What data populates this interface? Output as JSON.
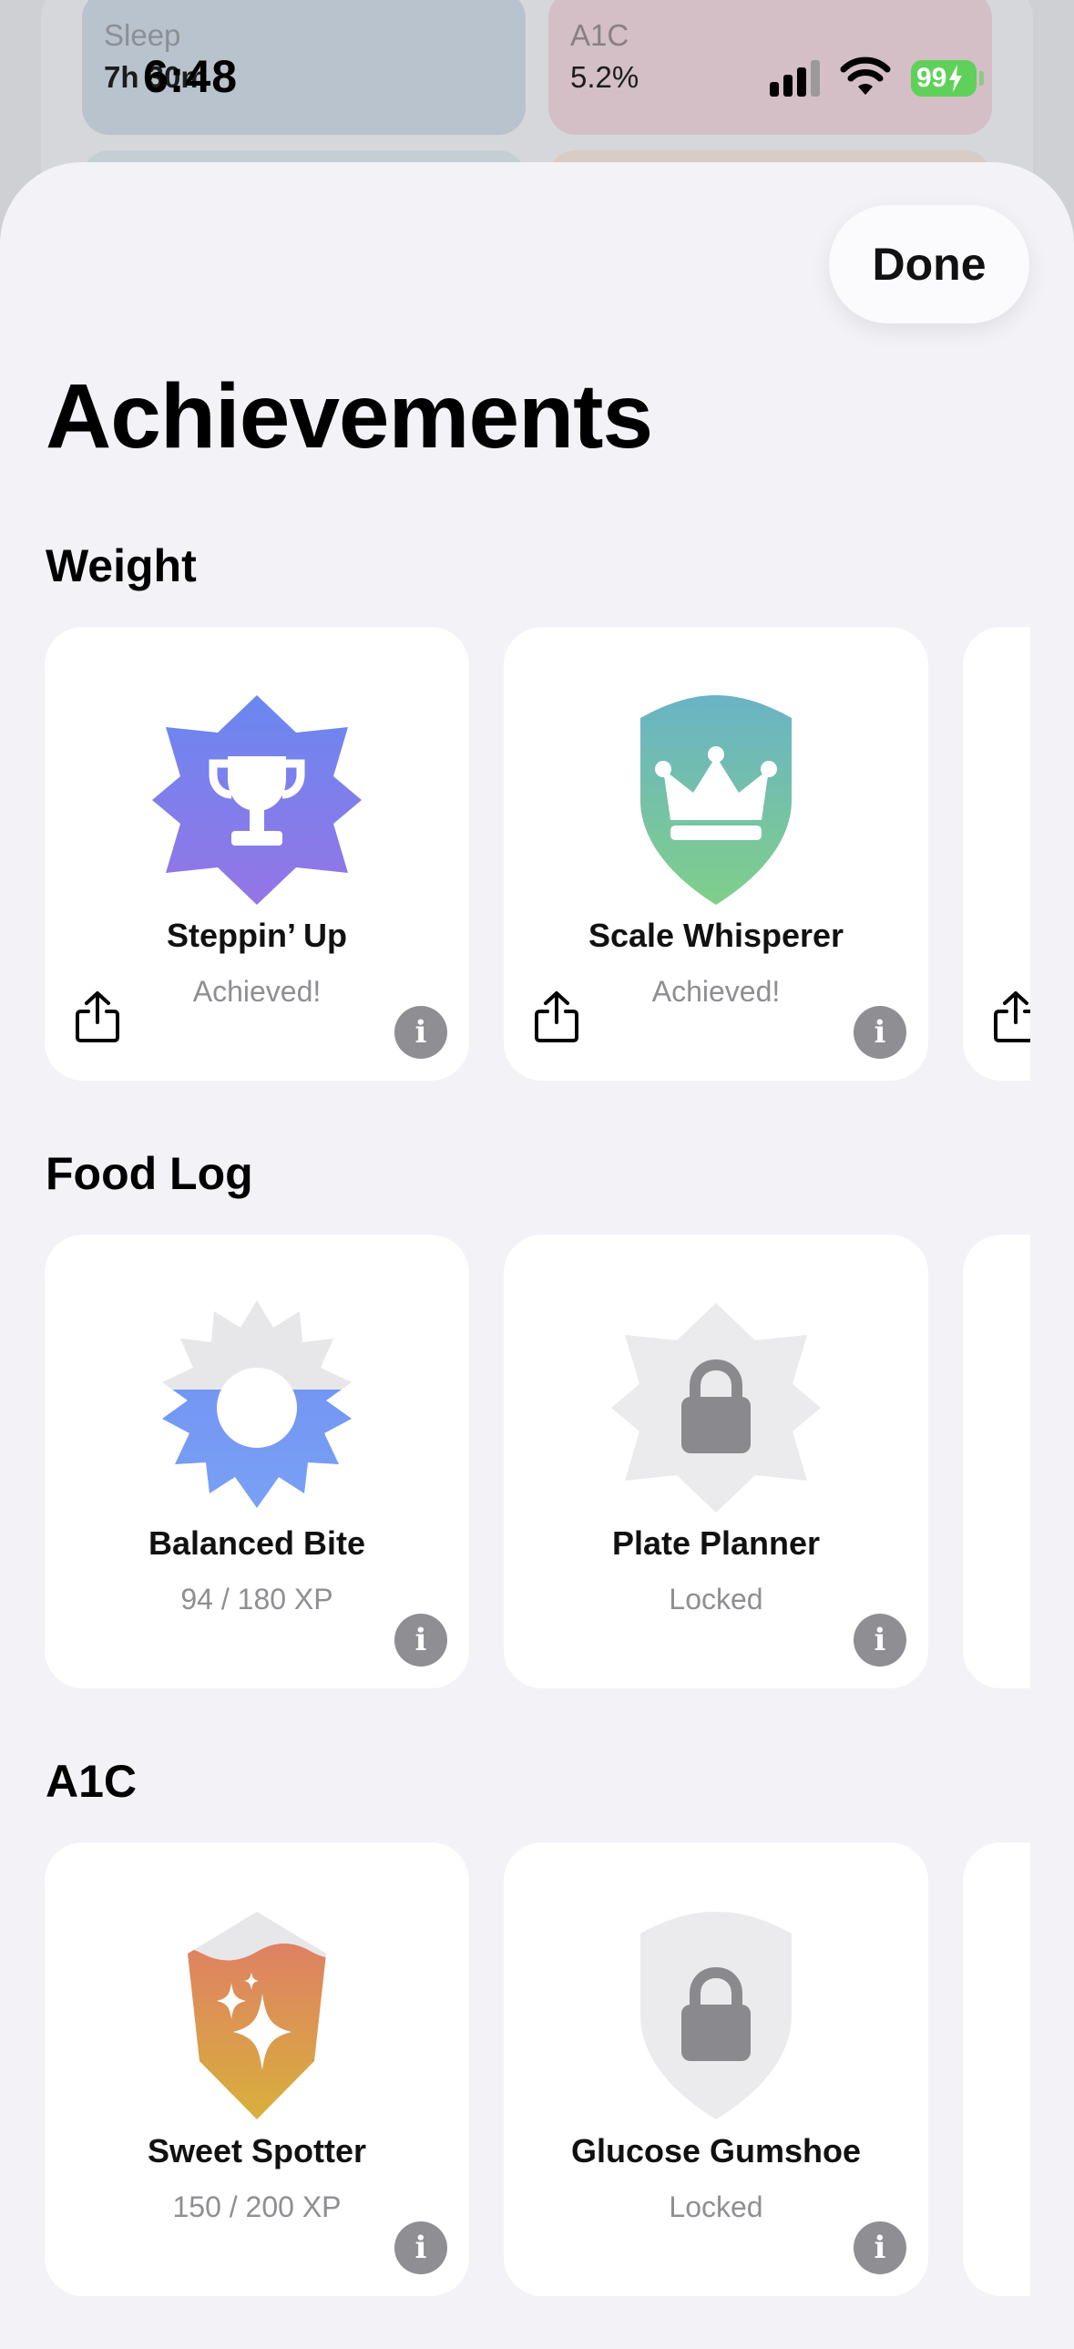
{
  "background": {
    "cards": [
      {
        "title": "Sleep",
        "value": "7h 30m"
      },
      {
        "title": "A1C",
        "value": "5.2%"
      }
    ]
  },
  "status_bar": {
    "time": "6:48",
    "battery": "99"
  },
  "header": {
    "done_label": "Done",
    "title": "Achievements"
  },
  "sections": [
    {
      "title": "Weight",
      "items": [
        {
          "name": "Steppin’ Up",
          "status": "Achieved!",
          "icon": "trophy-badge-icon"
        },
        {
          "name": "Scale Whisperer",
          "status": "Achieved!",
          "icon": "crown-shield-icon"
        }
      ]
    },
    {
      "title": "Food Log",
      "items": [
        {
          "name": "Balanced Bite",
          "status": "94 / 180 XP",
          "icon": "starburst-badge-icon",
          "progress": 0.52
        },
        {
          "name": "Plate Planner",
          "status": "Locked",
          "icon": "lock-icon"
        }
      ]
    },
    {
      "title": "A1C",
      "items": [
        {
          "name": "Sweet Spotter",
          "status": "150 / 200 XP",
          "icon": "sparkle-shield-icon",
          "progress": 0.75
        },
        {
          "name": "Glucose Gumshoe",
          "status": "Locked",
          "icon": "lock-icon"
        }
      ]
    }
  ],
  "colors": {
    "sheet_bg": "#f2f2f7",
    "secondary_text": "#8e8e93",
    "info_button": "#8e8e93",
    "battery": "#5fd15a"
  }
}
